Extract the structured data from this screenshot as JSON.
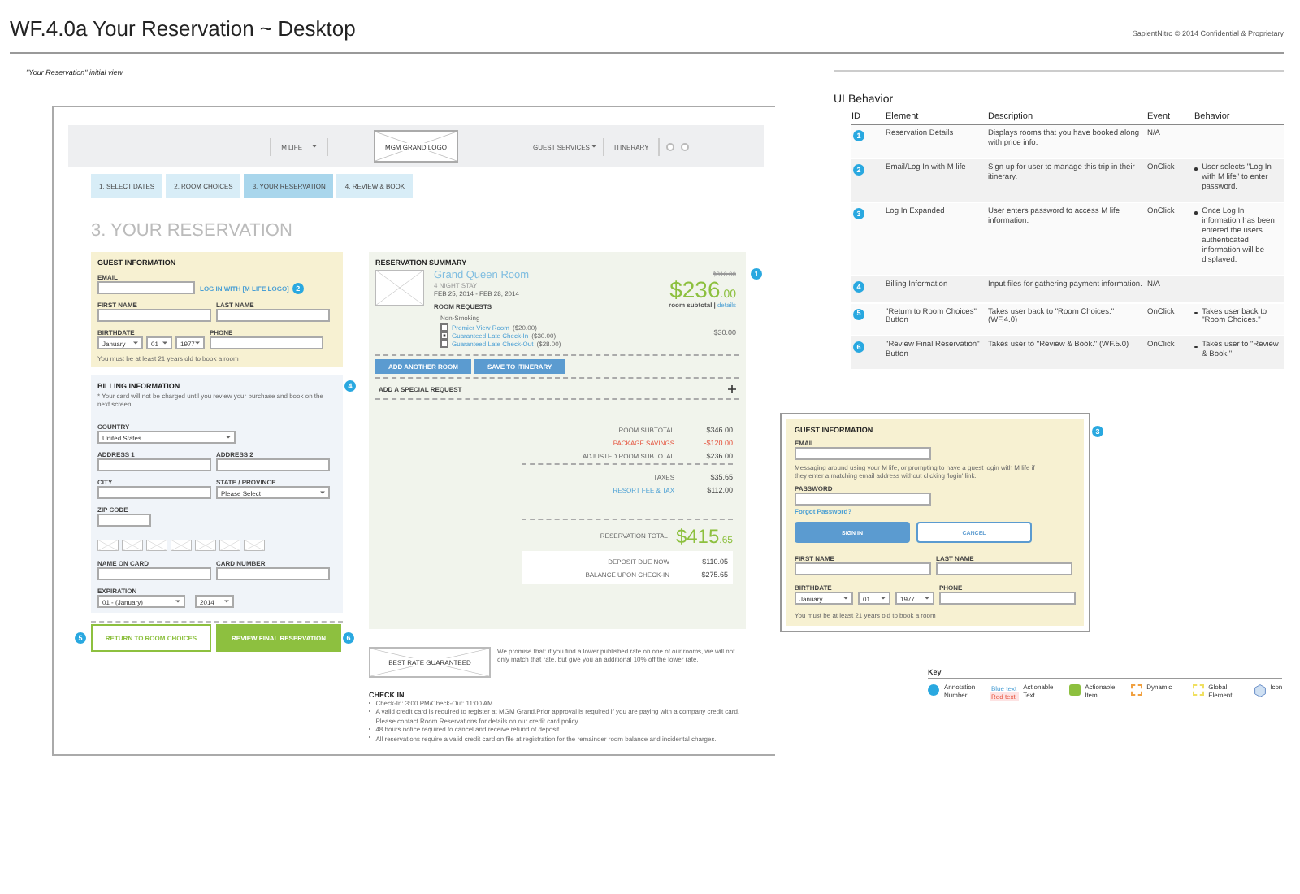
{
  "document": {
    "title": "WF.4.0a Your Reservation ~ Desktop",
    "copyright": "SapientNitro © 2014 Confidential & Proprietary",
    "caption": "\"Your Reservation\" initial view"
  },
  "wireframe": {
    "header": {
      "logo": "MGM GRAND LOGO",
      "menu": "M LIFE",
      "guest_services": "GUEST SERVICES",
      "itinerary": "ITINERARY"
    },
    "steps": [
      {
        "label": "1. SELECT DATES",
        "selected": false
      },
      {
        "label": "2. ROOM CHOICES",
        "selected": false
      },
      {
        "label": "3. YOUR RESERVATION",
        "selected": true
      },
      {
        "label": "4. REVIEW & BOOK",
        "selected": false
      }
    ],
    "heading": "3. YOUR RESERVATION",
    "guest": {
      "title": "GUEST INFORMATION",
      "email": "EMAIL",
      "login_link": "LOG IN WITH [M LIFE LOGO]",
      "annotation": "2",
      "first_name": "FIRST NAME",
      "last_name": "LAST NAME",
      "birthdate": "BIRTHDATE",
      "month": "January",
      "day": "01",
      "year": "1977",
      "phone": "PHONE",
      "note": "You must be at least 21 years old to book a room"
    },
    "billing": {
      "title": "BILLING INFORMATION",
      "note": "* Your card will not be charged until you review your purchase and book on the next screen",
      "annotation": "4",
      "country": "COUNTRY",
      "country_value": "United States",
      "address1": "ADDRESS 1",
      "address2": "ADDRESS 2",
      "city": "CITY",
      "state": "STATE / PROVINCE",
      "state_value": "Please Select",
      "zip": "ZIP CODE",
      "name_on_card": "NAME ON CARD",
      "card_number": "CARD NUMBER",
      "expiration": "EXPIRATION",
      "exp_month": "01 - (January)",
      "exp_year": "2014"
    },
    "actions": [
      {
        "label": "RETURN TO ROOM CHOICES",
        "kind": "secondary",
        "annotation": "5"
      },
      {
        "label": "REVIEW FINAL RESERVATION",
        "kind": "primary",
        "annotation": "6"
      }
    ],
    "summary": {
      "title": "RESERVATION SUMMARY",
      "annotation": "1",
      "room": "Grand Queen Room",
      "stay": "4 NIGHT STAY",
      "dates": "FEB 25, 2014 - FEB 28, 2014",
      "old_price": "$316.00",
      "price": "$236",
      "price_cents": ".00",
      "price_note": "room subtotal |",
      "details": "details",
      "requests_title": "ROOM REQUESTS",
      "non_smoking": "Non-Smoking",
      "requests": [
        {
          "label": "Premier View Room",
          "price": "($20.00)",
          "checked": false
        },
        {
          "label": "Guaranteed Late Check-In",
          "price": "($30.00)",
          "checked": true
        },
        {
          "label": "Guaranteed Late Check-Out",
          "price": "($28.00)",
          "checked": false
        }
      ],
      "request_total": "$30.00",
      "buttons": [
        "ADD ANOTHER ROOM",
        "SAVE TO ITINERARY"
      ],
      "special_request": "ADD A SPECIAL REQUEST",
      "lines": [
        {
          "label": "ROOM SUBTOTAL",
          "value": "$346.00",
          "kind": "normal"
        },
        {
          "label": "PACKAGE SAVINGS",
          "value": "-$120.00",
          "kind": "savings"
        },
        {
          "label": "ADJUSTED ROOM SUBTOTAL",
          "value": "$236.00",
          "kind": "normal"
        }
      ],
      "tax_lines": [
        {
          "label": "TAXES",
          "value": "$35.65",
          "kind": "normal"
        },
        {
          "label": "RESORT FEE & TAX",
          "value": "$112.00",
          "kind": "link"
        }
      ],
      "total_label": "RESERVATION TOTAL",
      "total": "$415",
      "total_cents": ".65",
      "deposit": [
        {
          "label": "DEPOSIT DUE NOW",
          "value": "$110.05"
        },
        {
          "label": "BALANCE UPON CHECK-IN",
          "value": "$275.65"
        }
      ]
    },
    "best_rate": {
      "badge": "BEST RATE GUARANTEED",
      "text": "We promise that: if you find a lower published rate on one of our rooms, we will not only match that rate, but give you an additional 10% off the lower rate."
    },
    "check_in": {
      "title": "CHECK IN",
      "items": [
        "Check-In: 3:00 PM/Check-Out: 11:00 AM.",
        "A valid credit card is required to register at MGM Grand.Prior approval is required if you are paying with a company credit card. Please contact Room Reservations for details on our credit card policy.",
        "48 hours notice required to cancel and receive refund of deposit.",
        "All reservations require a valid credit card on file at registration for the remainder room balance and incidental charges."
      ]
    }
  },
  "ui_behavior": {
    "title": "UI Behavior",
    "columns": [
      "ID",
      "Element",
      "Description",
      "Event",
      "Behavior"
    ],
    "rows": [
      {
        "id": "1",
        "element": "Reservation Details",
        "description": "Displays rooms that you have booked along with price info.",
        "event": "N/A",
        "behavior": []
      },
      {
        "id": "2",
        "element": "Email/Log In with M life",
        "description": "Sign up for user to manage this trip in their itinerary.",
        "event": "OnClick",
        "behavior": [
          "User selects \"Log In with M life\" to enter password."
        ]
      },
      {
        "id": "3",
        "element": "Log In Expanded",
        "description": "User enters password to access M life information.",
        "event": "OnClick",
        "behavior": [
          "Once Log In information has been entered the users authenticated information will be displayed."
        ]
      },
      {
        "id": "4",
        "element": "Billing Information",
        "description": "Input files for gathering payment information.",
        "event": "N/A",
        "behavior": []
      },
      {
        "id": "5",
        "element": "\"Return to Room Choices\" Button",
        "description": "Takes user back to \"Room Choices.\" (WF.4.0)",
        "event": "OnClick",
        "behavior": [
          "Takes user back to \"Room Choices.\""
        ]
      },
      {
        "id": "6",
        "element": "\"Review Final Reservation\" Button",
        "description": "Takes user to \"Review & Book.\" (WF.5.0)",
        "event": "OnClick",
        "behavior": [
          "Takes user to \"Review & Book.\""
        ]
      }
    ]
  },
  "login_expanded": {
    "annotation": "3",
    "title": "GUEST INFORMATION",
    "email": "EMAIL",
    "message": "Messaging around using your M life, or prompting to have a guest login with M life if they enter a matching email address without clicking 'login' link.",
    "password": "PASSWORD",
    "forgot": "Forgot Password?",
    "sign_in": "SIGN IN",
    "cancel": "CANCEL",
    "first_name": "FIRST NAME",
    "last_name": "LAST NAME",
    "birthdate": "BIRTHDATE",
    "month": "January",
    "day": "01",
    "year": "1977",
    "phone": "PHONE",
    "note": "You must be at least 21 years old to book a room"
  },
  "key": {
    "title": "Key",
    "items": [
      {
        "kind": "annotation",
        "label": "Annotation Number"
      },
      {
        "kind": "text",
        "label": "Actionable Text",
        "samples": [
          "Blue text",
          "Red text"
        ]
      },
      {
        "kind": "item",
        "label": "Actionable Item"
      },
      {
        "kind": "dynamic",
        "label": "Dynamic"
      },
      {
        "kind": "global",
        "label": "Global Element"
      },
      {
        "kind": "icon",
        "label": "Icon"
      }
    ]
  }
}
